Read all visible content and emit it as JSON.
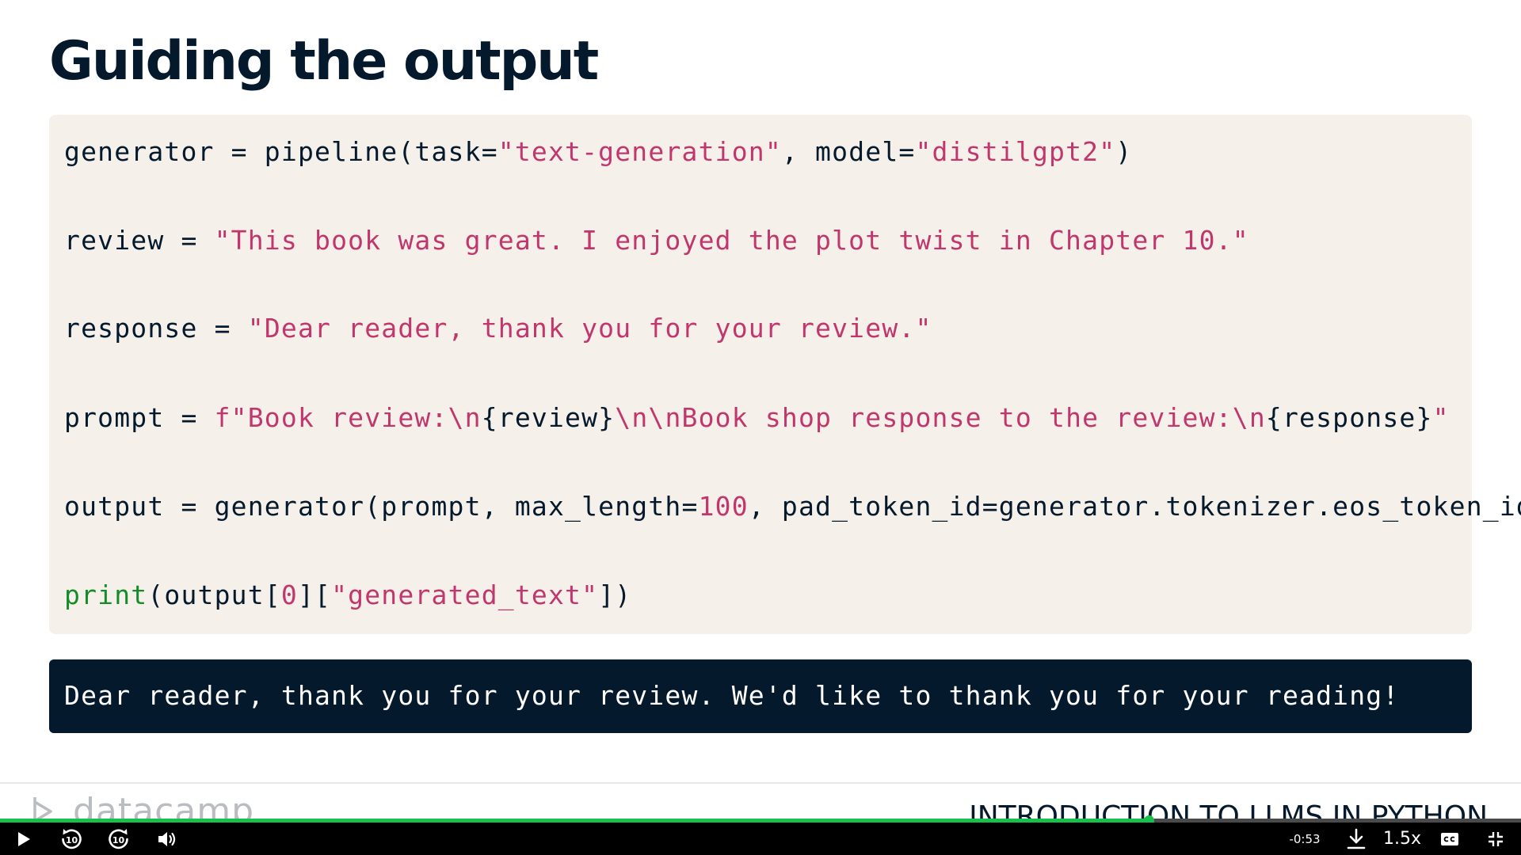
{
  "slide": {
    "title": "Guiding the output"
  },
  "code": {
    "line1": {
      "a": "generator = pipeline(task=",
      "b": "\"text-generation\"",
      "c": ", model=",
      "d": "\"distilgpt2\"",
      "e": ")"
    },
    "line2": {
      "a": "review = ",
      "b": "\"This book was great. I enjoyed the plot twist in Chapter 10.\""
    },
    "line3": {
      "a": "response = ",
      "b": "\"Dear reader, thank you for your review.\""
    },
    "line4": {
      "a": "prompt = ",
      "b": "f\"Book review:\\n",
      "c": "{review}",
      "d": "\\n\\nBook shop response to the review:\\n",
      "e": "{response}",
      "f": "\""
    },
    "line5": {
      "a": "output = generator(prompt, max_length=",
      "b": "100",
      "c": ", pad_token_id=generator.tokenizer.eos_token_id)"
    },
    "line6": {
      "a": "print",
      "b": "(output[",
      "c": "0",
      "d": "][",
      "e": "\"generated_text\"",
      "f": "])"
    }
  },
  "output": {
    "text": "Dear reader, thank you for your review. We'd like to thank you for your reading!"
  },
  "footer": {
    "logo_text": "datacamp",
    "course_title": "INTRODUCTION TO LLMS IN PYTHON"
  },
  "player": {
    "progress": 0.755,
    "time_remaining": "-0:53",
    "speed": "1.5x",
    "skip_back_seconds": "10",
    "skip_forward_seconds": "10"
  },
  "colors": {
    "accent_green": "#17c24a",
    "string_pink": "#c1376d",
    "builtin_green": "#158b29",
    "navy": "#05192d",
    "code_bg": "#f5f0e9"
  }
}
